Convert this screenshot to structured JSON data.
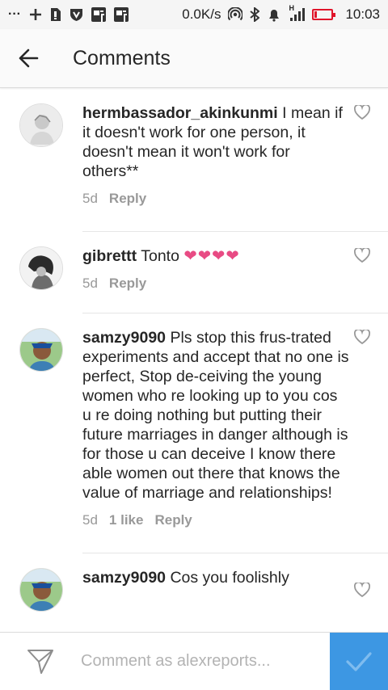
{
  "status_bar": {
    "dots": "···",
    "net_speed": "0.0K/s",
    "signal_tag": "H",
    "time": "10:03",
    "battery_color": "#e0152b"
  },
  "header": {
    "title": "Comments",
    "back_icon": "arrow-left-icon"
  },
  "comments": [
    {
      "username": "hermbassador_akinkunmi",
      "text": "I mean if it doesn't work for one person, it doesn't mean it won't work for others**",
      "hearts": "",
      "time": "5d",
      "likes": "",
      "reply_label": "Reply"
    },
    {
      "username": "gibrettt",
      "text": "Tonto",
      "hearts": "❤❤❤❤",
      "time": "5d",
      "likes": "",
      "reply_label": "Reply"
    },
    {
      "username": "samzy9090",
      "text": "Pls stop this frus-trated experiments and accept that no one is perfect, Stop de-ceiving the young women who re looking up to you cos u re doing nothing but putting  their future marriages in danger although is for those u can deceive I know there able women out there that knows the value of marriage and relationships!",
      "hearts": "",
      "time": "5d",
      "likes": "1 like",
      "reply_label": "Reply"
    },
    {
      "username": "samzy9090",
      "text": "Cos you foolishly",
      "hearts": "",
      "time": "",
      "likes": "",
      "reply_label": ""
    }
  ],
  "composer": {
    "placeholder": "Comment as alexreports...",
    "post_button_color": "#3d97e3"
  }
}
